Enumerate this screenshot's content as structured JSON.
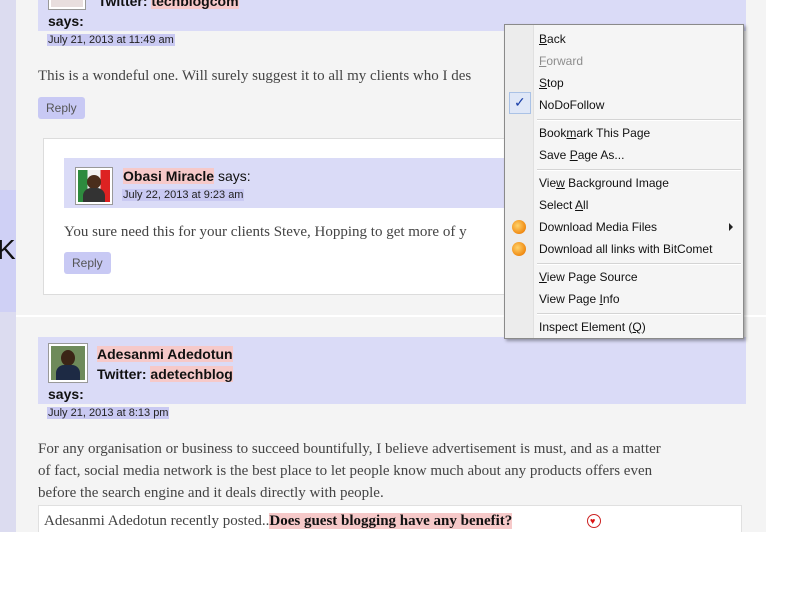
{
  "comment1": {
    "twitter_label": "Twitter:",
    "twitter_handle": "techblogcom",
    "says": "says:",
    "date": "July 21, 2013 at 11:49 am",
    "body": "This is a wondeful one. Will surely suggest it to all my clients who I des",
    "reply": "Reply"
  },
  "comment2": {
    "author": "Obasi Miracle",
    "says": "says:",
    "date": "July 22, 2013 at 9:23 am",
    "body": "You sure need this for your clients Steve, Hopping to get more of y",
    "reply": "Reply"
  },
  "comment3": {
    "author": "Adesanmi Adedotun",
    "twitter_label": "Twitter:",
    "twitter_handle": "adetechblog",
    "says": "says:",
    "date": "July 21, 2013 at 8:13 pm",
    "body_lines": [
      "For any organisation or business to succeed bountifully, I believe advertisement is must, and as a matter",
      "of fact, social media network is the best place to let people know much about any products offers even",
      "before the search engine and it deals directly with people."
    ],
    "recently_posted": "Adesanmi Adedotun recently posted..",
    "posted_link": "Does guest blogging have any benefit?"
  },
  "left_tab_glyph": "K",
  "context_menu": {
    "items": [
      {
        "label_pre": "",
        "accel": "B",
        "label_post": "ack"
      },
      {
        "label_pre": "",
        "accel": "F",
        "label_post": "orward",
        "disabled": true
      },
      {
        "label_pre": "",
        "accel": "S",
        "label_post": "top"
      },
      {
        "label_pre": "NoDoFollow",
        "accel": "",
        "label_post": "",
        "checked": true
      },
      {
        "label_pre": "Book",
        "accel": "m",
        "label_post": "ark This Page"
      },
      {
        "label_pre": "Save ",
        "accel": "P",
        "label_post": "age As..."
      },
      {
        "label_pre": "Vie",
        "accel": "w",
        "label_post": " Background Image"
      },
      {
        "label_pre": "Select ",
        "accel": "A",
        "label_post": "ll"
      },
      {
        "label_pre": "Download Media Files",
        "accel": "",
        "label_post": "",
        "icon": "media-download-icon",
        "submenu": true
      },
      {
        "label_pre": "Download all links with BitComet",
        "accel": "",
        "label_post": "",
        "icon": "bitcomet-icon"
      },
      {
        "label_pre": "",
        "accel": "V",
        "label_post": "iew Page Source"
      },
      {
        "label_pre": "View Page ",
        "accel": "I",
        "label_post": "nfo"
      },
      {
        "label_pre": "Inspect Element (",
        "accel": "Q",
        "label_post": ")"
      }
    ],
    "check_glyph": "✓"
  },
  "colors": {
    "band": "#dadbf7",
    "date_highlight": "#c9c9f2",
    "name_highlight": "#f6c9c9",
    "reply_bg": "#c8c9f4"
  }
}
